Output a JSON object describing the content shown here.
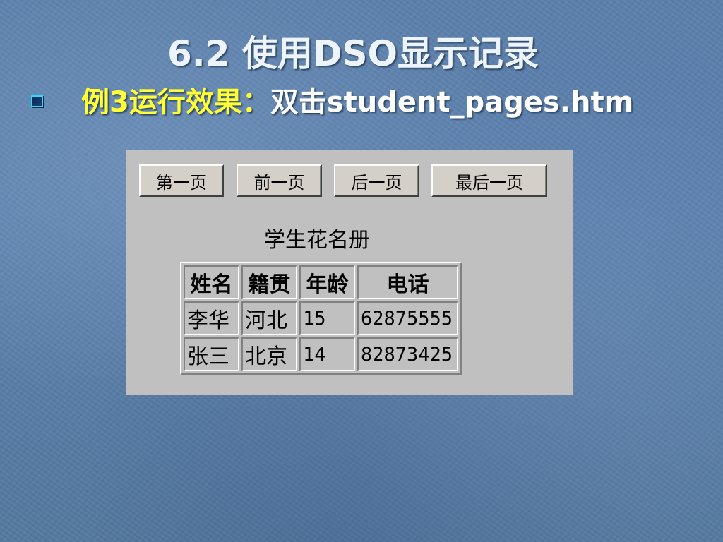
{
  "slide": {
    "title_num": "6.2 ",
    "title_text": "使用DSO显示记录"
  },
  "bullet": {
    "icon": "square-bullet-icon",
    "highlight_text": "例3运行效果：",
    "rest_text": "双击student_pages.htm"
  },
  "toolbar": {
    "first_label": "第一页",
    "prev_label": "前一页",
    "next_label": "后一页",
    "last_label": "最后一页"
  },
  "table": {
    "caption": "学生花名册",
    "columns": [
      "姓名",
      "籍贯",
      "年龄",
      "电话"
    ],
    "rows": [
      [
        "李华",
        "河北",
        "15",
        "62875555"
      ],
      [
        "张三",
        "北京",
        "14",
        "82873425"
      ]
    ]
  },
  "colors": {
    "background": "#5a7fab",
    "title_text": "#eef4fb",
    "highlight_text": "#ffff33",
    "bullet_border": "#1fe0ff",
    "panel_gray": "#c0c0c0",
    "button_face": "#d4d0c8"
  }
}
